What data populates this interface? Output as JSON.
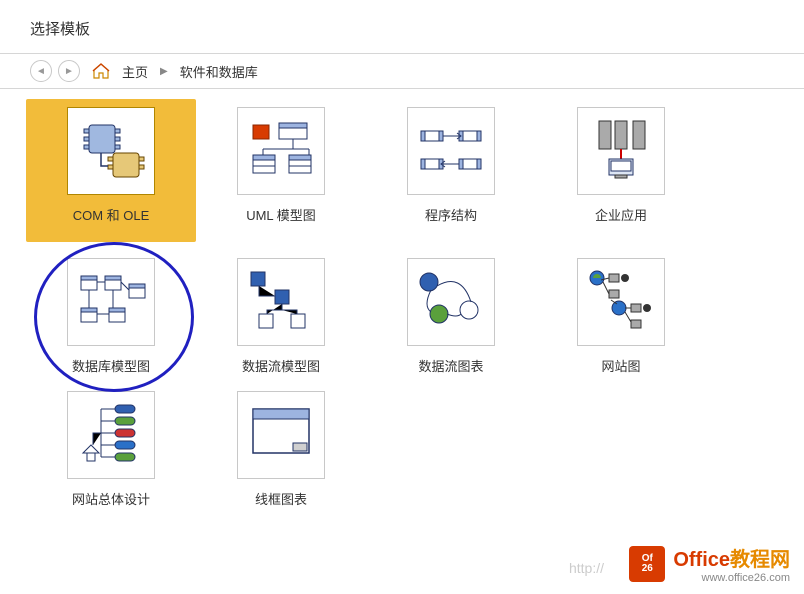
{
  "header": {
    "title": "选择模板"
  },
  "breadcrumb": {
    "home": "主页",
    "current": "软件和数据库"
  },
  "templates": [
    {
      "label": "COM 和 OLE",
      "selected": true
    },
    {
      "label": "UML 模型图"
    },
    {
      "label": "程序结构"
    },
    {
      "label": "企业应用"
    },
    {
      "label": "数据库模型图"
    },
    {
      "label": "数据流模型图"
    },
    {
      "label": "数据流图表"
    },
    {
      "label": "网站图"
    },
    {
      "label": "网站总体设计"
    },
    {
      "label": "线框图表"
    }
  ],
  "watermark": {
    "brand_a": "Office",
    "brand_b": "教程网",
    "url": "www.office26.com",
    "http": "http://"
  }
}
